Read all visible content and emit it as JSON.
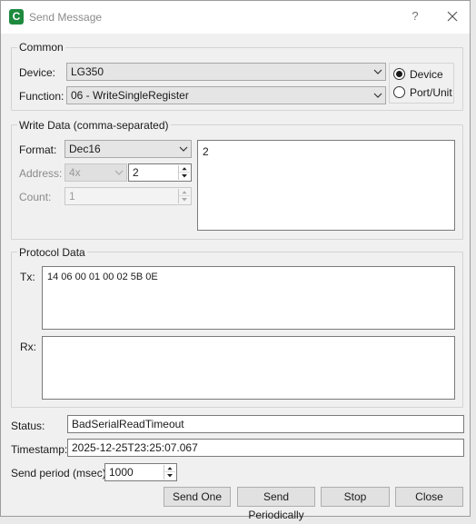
{
  "window": {
    "title": "Send Message",
    "help_glyph": "?",
    "icon_letter": "C"
  },
  "common": {
    "title": "Common",
    "device_label": "Device:",
    "device_value": "LG350",
    "function_label": "Function:",
    "function_value": "06 - WriteSingleRegister",
    "target_options": [
      {
        "label": "Device",
        "selected": true
      },
      {
        "label": "Port/Unit",
        "selected": false
      }
    ]
  },
  "write_data": {
    "title": "Write Data (comma-separated)",
    "format_label": "Format:",
    "format_value": "Dec16",
    "address_label": "Address:",
    "address_type": "4x",
    "address_value": "2",
    "count_label": "Count:",
    "count_value": "1",
    "data_text": "2"
  },
  "protocol": {
    "title": "Protocol Data",
    "tx_label": "Tx:",
    "tx_value": "14 06 00 01 00 02 5B 0E",
    "rx_label": "Rx:",
    "rx_value": ""
  },
  "status": {
    "status_label": "Status:",
    "status_value": "BadSerialReadTimeout",
    "timestamp_label": "Timestamp:",
    "timestamp_value": "2025-12-25T23:25:07.067",
    "period_label": "Send period (msec):",
    "period_value": "1000"
  },
  "buttons": {
    "send_one": "Send One",
    "send_periodically": "Send Periodically",
    "stop": "Stop",
    "close": "Close"
  }
}
